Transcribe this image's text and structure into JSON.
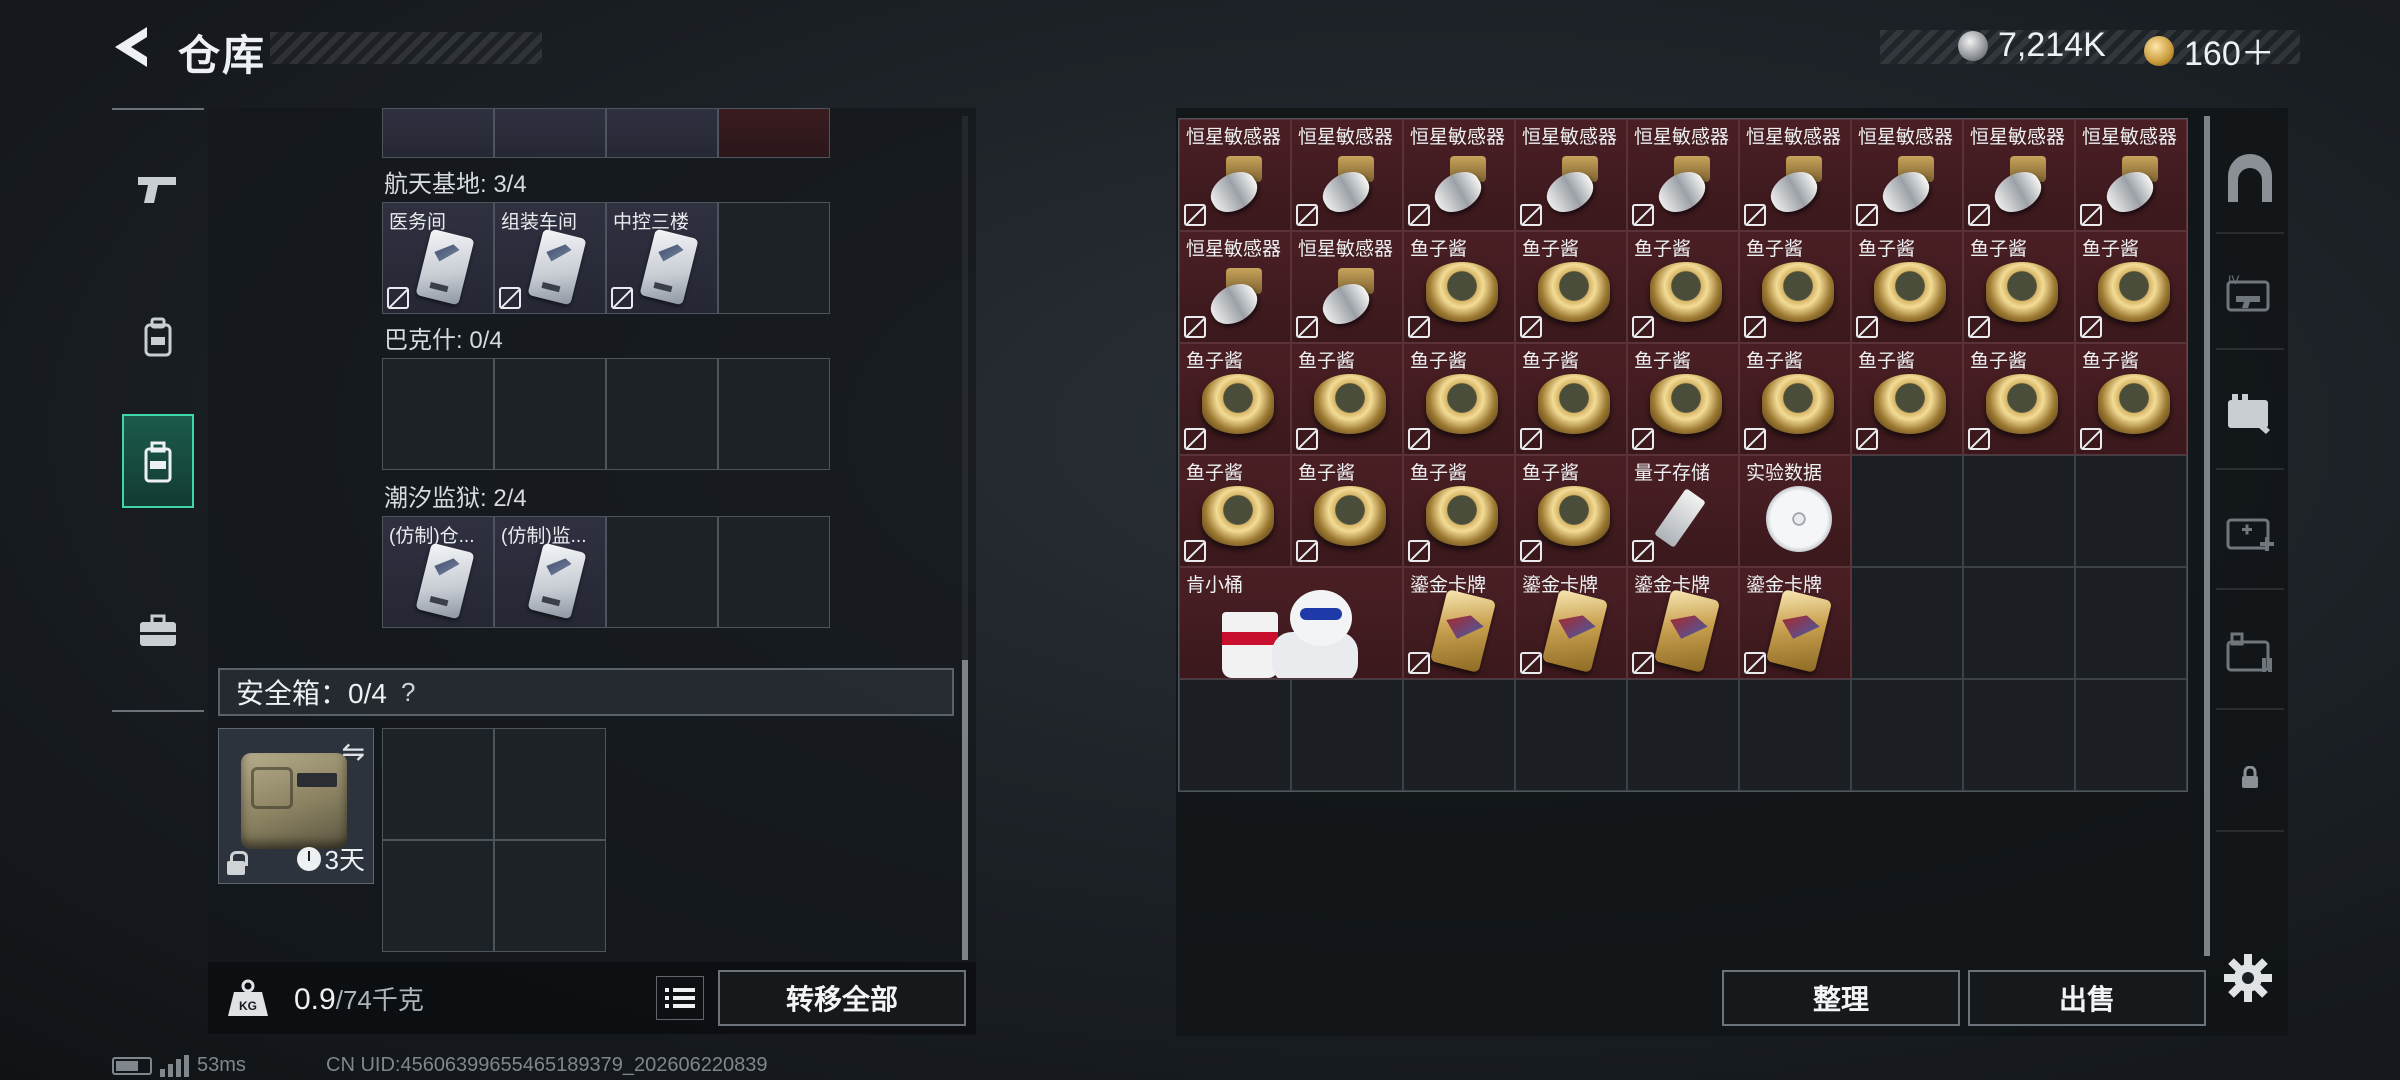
{
  "header": {
    "title": "仓库",
    "currency_silver": "7,214K",
    "currency_gold": "160＋"
  },
  "left_nav": {
    "items": [
      {
        "icon": "pistol-icon"
      },
      {
        "icon": "backpack-icon"
      },
      {
        "icon": "container-icon",
        "active": true
      },
      {
        "icon": "toolbox-icon"
      }
    ]
  },
  "containers": {
    "sections": [
      {
        "label": "航天基地: 3/4",
        "slots": [
          "医务间",
          "组装车间",
          "中控三楼",
          ""
        ]
      },
      {
        "label": "巴克什: 0/4",
        "slots": [
          "",
          "",
          "",
          ""
        ]
      },
      {
        "label": "潮汐监狱: 2/4",
        "slots": [
          "(仿制)仓...",
          "(仿制)监...",
          "",
          ""
        ]
      }
    ],
    "safe_box_label": "安全箱：0/4",
    "safe_box_help": "?",
    "safe_box_days": "3天"
  },
  "footer_left": {
    "weight_value": "0.9",
    "weight_capacity": "/74千克",
    "transfer_all": "转移全部"
  },
  "status_bar": {
    "ping": "53ms",
    "uid": "CN UID:4560639965546518937​9_202606220839"
  },
  "inventory": {
    "rows": [
      [
        "恒星敏感器",
        "恒星敏感器",
        "恒星敏感器",
        "恒星敏感器",
        "恒星敏感器",
        "恒星敏感器",
        "恒星敏感器",
        "恒星敏感器",
        "恒星敏感器"
      ],
      [
        "恒星敏感器",
        "恒星敏感器",
        "鱼子酱",
        "鱼子酱",
        "鱼子酱",
        "鱼子酱",
        "鱼子酱",
        "鱼子酱",
        "鱼子酱"
      ],
      [
        "鱼子酱",
        "鱼子酱",
        "鱼子酱",
        "鱼子酱",
        "鱼子酱",
        "鱼子酱",
        "鱼子酱",
        "鱼子酱",
        "鱼子酱"
      ],
      [
        "鱼子酱",
        "鱼子酱",
        "鱼子酱",
        "鱼子酱",
        "量子存储",
        "实验数据",
        "",
        "",
        ""
      ],
      [
        "肯小桶",
        "",
        "鎏金卡牌",
        "鎏金卡牌",
        "鎏金卡牌",
        "鎏金卡牌",
        "",
        "",
        ""
      ],
      [
        "",
        "",
        "",
        "",
        "",
        "",
        "",
        "",
        ""
      ]
    ]
  },
  "actions": {
    "sort": "整理",
    "sell": "出售"
  },
  "colors": {
    "accent": "#3fd6a8",
    "rare_red": "#4a1f24",
    "panel": "#1b1f23"
  }
}
